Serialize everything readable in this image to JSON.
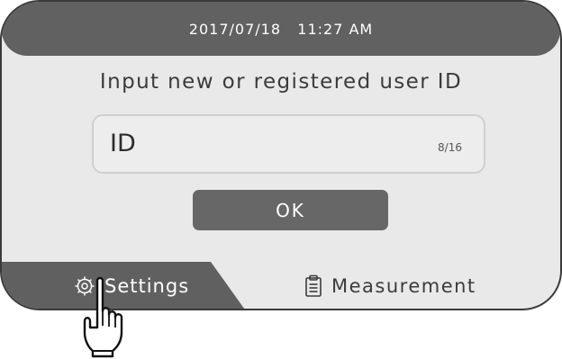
{
  "status_bar": {
    "date": "2017/07/18",
    "time": "11:27 AM"
  },
  "prompt": "Input new or registered user ID",
  "id_field": {
    "value": "ID",
    "counter": "8/16"
  },
  "ok_button": {
    "label": "OK"
  },
  "tabs": [
    {
      "label": "Settings",
      "icon": "gear-icon",
      "active": true
    },
    {
      "label": "Measurement",
      "icon": "clipboard-icon",
      "active": false
    }
  ],
  "pointer": {
    "icon": "hand-pointer-icon"
  },
  "colors": {
    "screen_background": "#e9e9e9",
    "bar_dark": "#616161",
    "button": "#676767",
    "text_dark": "#3b3b3b"
  }
}
